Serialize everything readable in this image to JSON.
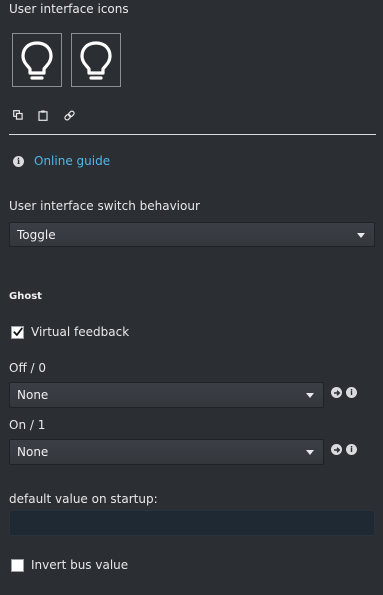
{
  "icons_section": {
    "title": "User interface icons",
    "icon_slots": [
      "bulb-icon",
      "bulb-icon"
    ],
    "tools": [
      "copy-icon",
      "paste-icon",
      "link-icon"
    ]
  },
  "guide": {
    "link_label": "Online guide"
  },
  "switch_behaviour": {
    "label": "User interface switch behaviour",
    "selected": "Toggle"
  },
  "ghost": {
    "title": "Ghost",
    "virtual_feedback": {
      "label": "Virtual feedback",
      "checked": true
    },
    "off": {
      "label": "Off / 0",
      "selected": "None"
    },
    "on": {
      "label": "On / 1",
      "selected": "None"
    }
  },
  "startup": {
    "label": "default value on startup:",
    "value": ""
  },
  "invert": {
    "label": "Invert bus value",
    "checked": false
  },
  "colors": {
    "background": "#2b2e33",
    "link": "#4fb7ea",
    "select": "#3b3f45",
    "input": "#1f2933"
  }
}
